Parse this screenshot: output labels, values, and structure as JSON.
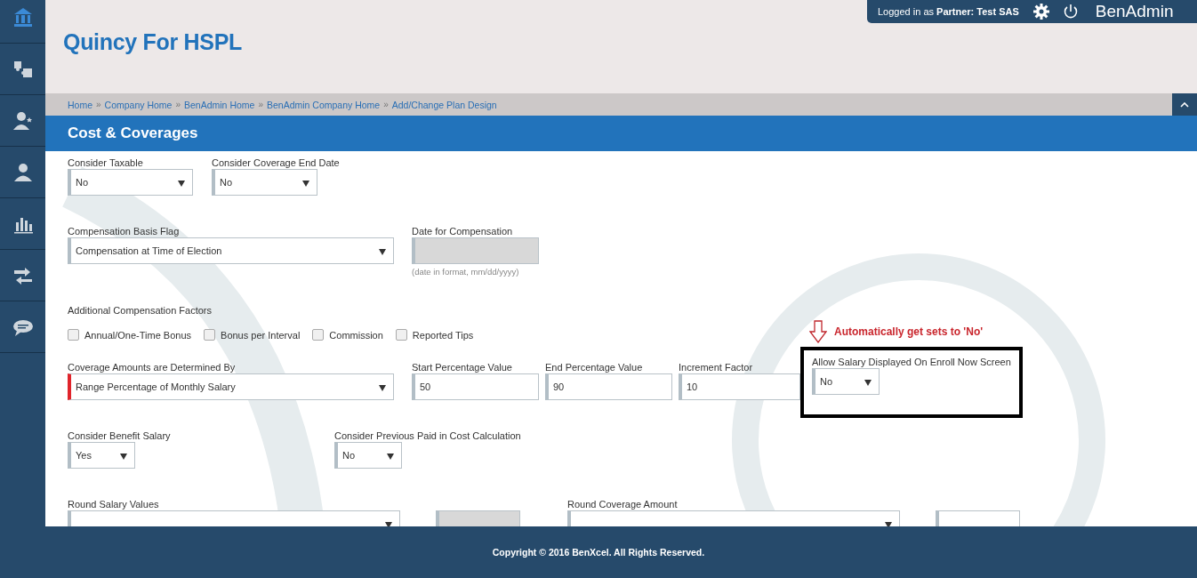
{
  "top_bar": {
    "login": "Logged in as **Partner:  Test SAS**",
    "brand": "BenAdmin"
  },
  "page_title": "Quincy For HSPL",
  "breadcrumb": [
    {
      "label": "Home"
    },
    {
      "separator": "»",
      "label": "Company Home"
    },
    {
      "separator": "»",
      "label": "BenAdmin Home"
    },
    {
      "separator": "»",
      "label": "BenAdmin Company Home"
    },
    {
      "separator": "»",
      "label": "Add/Change Plan Design"
    }
  ],
  "section_title": "Cost & Coverages",
  "rows": [
    {
      "fields": [
        {
          "kind": "select",
          "label": "Consider Taxable",
          "value": "No",
          "required": false
        },
        {
          "kind": "select",
          "label": "Consider Coverage End Date",
          "value": "No",
          "required": false
        }
      ]
    },
    {
      "fields": [
        {
          "kind": "select",
          "label": "Compensation Basis Flag",
          "value": "Compensation at Time of Election",
          "required": false
        },
        {
          "kind": "date",
          "label": "Date for Compensation",
          "hint": "(date in format, mm/dd/yyyy)",
          "disabled": true
        }
      ]
    },
    {
      "fields": [
        {
          "kind": "checkboxes",
          "label": "Additional Compensation Factors",
          "options": [
            {
              "label": "Annual/One-Time Bonus",
              "checked": false
            },
            {
              "label": "Bonus per Interval",
              "checked": false
            },
            {
              "label": "Commission",
              "checked": false
            },
            {
              "label": "Reported Tips",
              "checked": false
            }
          ]
        }
      ]
    },
    {
      "fields": [
        {
          "kind": "select",
          "label": "Coverage Amounts are Determined By",
          "value": "Range Percentage of Monthly Salary",
          "required": true
        },
        {
          "kind": "input",
          "label": "Start Percentage Value",
          "value": "50",
          "required": false
        },
        {
          "kind": "input",
          "label": "End Percentage Value",
          "value": "90",
          "required": false
        },
        {
          "kind": "input",
          "label": "Increment Factor",
          "value": "10",
          "required": false
        },
        {
          "kind": "select",
          "label": "Allow Salary Displayed On Enroll Now Screen",
          "value": "No",
          "required": false,
          "highlighted": true,
          "note": "Automatically get sets to 'No'"
        }
      ]
    },
    {
      "fields": [
        {
          "kind": "select",
          "label": "Consider Benefit Salary",
          "value": "Yes",
          "required": false
        },
        {
          "kind": "select",
          "label": "Consider Previous Paid in Cost Calculation",
          "value": "No",
          "required": false
        }
      ]
    },
    {
      "fields": [
        {
          "kind": "select",
          "label": "Round Salary Values",
          "required": false
        },
        {
          "kind": "date",
          "disabled": true
        },
        {
          "kind": "select",
          "label": "Round Coverage Amount",
          "required": false
        },
        {
          "kind": "input",
          "required": false
        }
      ]
    }
  ],
  "footer": "Copyright © 2016 BenXcel. All Rights Reserved."
}
